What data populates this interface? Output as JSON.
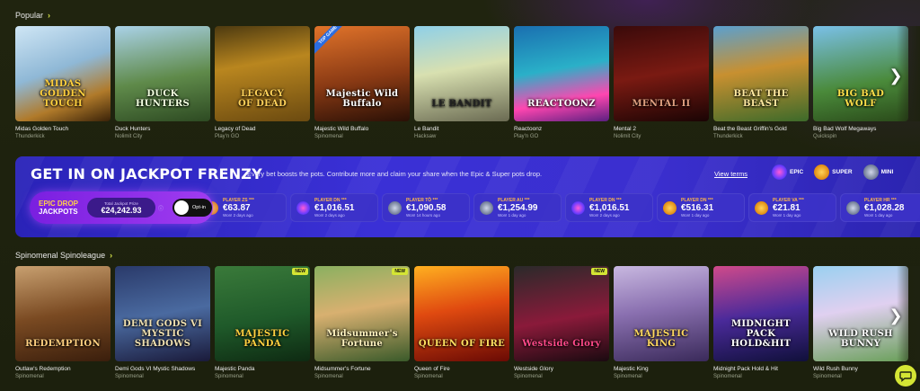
{
  "popular": {
    "title": "Popular",
    "games": [
      {
        "name": "Midas Golden Touch",
        "provider": "Thunderkick",
        "logo": "MIDAS\nGOLDEN TOUCH",
        "bg": "linear-gradient(160deg,#cfe6f5 0%,#8fb8d6 45%,#b07a2a 75%,#3a2208 100%)",
        "logo_color": "#ffcf3d"
      },
      {
        "name": "Duck Hunters",
        "provider": "Nolimit City",
        "logo": "DUCK HUNTERS",
        "bg": "linear-gradient(170deg,#aad2e8 0%,#5f8a4a 55%,#2d4a22 100%)",
        "logo_color": "#f2ffe0"
      },
      {
        "name": "Legacy of Dead",
        "provider": "Play'n GO",
        "logo": "LEGACY\nOF DEAD",
        "bg": "linear-gradient(170deg,#4d3a10 0%,#b9861f 40%,#6b4a10 100%)",
        "logo_color": "#ffd25a"
      },
      {
        "name": "Majestic Wild Buffalo",
        "provider": "Spinomenal",
        "logo": "Majestic Wild Buffalo",
        "bg": "linear-gradient(170deg,#e0732a 0%,#8a3a14 55%,#2a1006 100%)",
        "logo_color": "#ffffff",
        "badge": "TOP GAME"
      },
      {
        "name": "Le Bandit",
        "provider": "Hacksaw",
        "logo": "LE BANDIT",
        "bg": "linear-gradient(170deg,#8fd0e8 0%,#d8e0b0 45%,#6a6a52 100%)",
        "logo_color": "#222222"
      },
      {
        "name": "Reactoonz",
        "provider": "Play'n GO",
        "logo": "REACTOONZ",
        "bg": "linear-gradient(170deg,#1a6fb0 0%,#2ab0c8 45%,#ff46b0 75%,#5a1f80 100%)",
        "logo_color": "#ffffff"
      },
      {
        "name": "Mental 2",
        "provider": "Nolimit City",
        "logo": "MENTAL II",
        "bg": "linear-gradient(170deg,#3a0a0a 0%,#7a1a12 50%,#1a0404 100%)",
        "logo_color": "#e0a080"
      },
      {
        "name": "Beat the Beast Griffin's Gold",
        "provider": "Thunderkick",
        "logo": "BEAT THE BEAST",
        "bg": "linear-gradient(170deg,#5aa0d0 0%,#c89030 45%,#3c6a2a 100%)",
        "logo_color": "#ffe9a0"
      },
      {
        "name": "Big Bad Wolf Megaways",
        "provider": "Quickspin",
        "logo": "BIG BAD\nWOLF",
        "bg": "linear-gradient(170deg,#7ac0e8 0%,#4a8a3a 60%,#2a4a1a 100%)",
        "logo_color": "#ffe04a"
      }
    ]
  },
  "jackpot": {
    "title": "GET IN ON JACKPOT FRENZY",
    "subtitle": "Every bet boosts the pots. Contribute more and claim your share when the Epic & Super pots drop.",
    "view_terms": "View terms",
    "tiers": [
      {
        "label": "EPIC",
        "icon": "epic-gem"
      },
      {
        "label": "SUPER",
        "icon": "super-gem"
      },
      {
        "label": "MINI",
        "icon": "mini-gem"
      }
    ],
    "epic_drop_line1": "EPIC DROP",
    "epic_drop_line2": "JACKPOTS",
    "total_label": "Total Jackpot Prize",
    "total_value": "€24,242.93",
    "info_glyph": "ⓘ",
    "optin_label": "Opt-in",
    "winners": [
      {
        "player": "PLAYER ZS ***",
        "amount": "€63.87",
        "won": "Won! 2 days ago",
        "tier": "super"
      },
      {
        "player": "PLAYER DN ***",
        "amount": "€1,016.51",
        "won": "Won! 2 days ago",
        "tier": "epic"
      },
      {
        "player": "PLAYER TÖ ***",
        "amount": "€1,090.58",
        "won": "Won! 14 hours ago",
        "tier": "mini"
      },
      {
        "player": "PLAYER AU ***",
        "amount": "€1,254.99",
        "won": "Won! 1 day ago",
        "tier": "mini"
      },
      {
        "player": "PLAYER DN ***",
        "amount": "€1,016.51",
        "won": "Won! 2 days ago",
        "tier": "epic"
      },
      {
        "player": "PLAYER DN ***",
        "amount": "€516.31",
        "won": "Won! 1 day ago",
        "tier": "super"
      },
      {
        "player": "PLAYER VA ***",
        "amount": "€21.81",
        "won": "Won! 1 day ago",
        "tier": "super"
      },
      {
        "player": "PLAYER HR ***",
        "amount": "€1,028.28",
        "won": "Won! 1 day ago",
        "tier": "mini"
      }
    ]
  },
  "spinoleague": {
    "title": "Spinomenal Spinoleague",
    "games": [
      {
        "name": "Outlaw's Redemption",
        "provider": "Spinomenal",
        "logo": "REDEMPTION",
        "bg": "linear-gradient(170deg,#c8a070 0%,#7a4a22 50%,#3a1e0c 100%)",
        "logo_color": "#ffd080"
      },
      {
        "name": "Demi Gods VI Mystic Shadows",
        "provider": "Spinomenal",
        "logo": "DEMI GODS VI\nMYSTIC SHADOWS",
        "bg": "linear-gradient(170deg,#2a3a6a 0%,#4a6aa0 50%,#1a1a3a 100%)",
        "logo_color": "#f0e0b0"
      },
      {
        "name": "Majestic Panda",
        "provider": "Spinomenal",
        "logo": "MAJESTIC PANDA",
        "bg": "linear-gradient(170deg,#3a7a3a 0%,#1f5a2a 55%,#0e2a12 100%)",
        "logo_color": "#ffd040",
        "badge_new": "NEW"
      },
      {
        "name": "Midsummer's Fortune",
        "provider": "Spinomenal",
        "logo": "Midsummer's\nFortune",
        "bg": "linear-gradient(170deg,#8ab060 0%,#d8b070 45%,#3a5a2a 100%)",
        "logo_color": "#fff3c0",
        "badge_new": "NEW"
      },
      {
        "name": "Queen of Fire",
        "provider": "Spinomenal",
        "logo": "QUEEN OF FIRE",
        "bg": "linear-gradient(170deg,#ffb020 0%,#e04a10 45%,#6a0a04 100%)",
        "logo_color": "#ffe060"
      },
      {
        "name": "Westside Glory",
        "provider": "Spinomenal",
        "logo": "Westside Glory",
        "bg": "linear-gradient(170deg,#2a2a2a 0%,#8a1a3a 55%,#1a0a10 100%)",
        "logo_color": "#ff4a8a",
        "badge_new": "NEW"
      },
      {
        "name": "Majestic King",
        "provider": "Spinomenal",
        "logo": "MAJESTIC\nKING",
        "bg": "linear-gradient(170deg,#c8b8e0 0%,#8a70b0 45%,#3a2a5a 100%)",
        "logo_color": "#ffd860"
      },
      {
        "name": "Midnight Pack Hold & Hit",
        "provider": "Spinomenal",
        "logo": "MIDNIGHT PACK\nHOLD&HIT",
        "bg": "linear-gradient(170deg,#d04a8a 0%,#4a2a9a 50%,#10103a 100%)",
        "logo_color": "#ffffff"
      },
      {
        "name": "Wild Rush Bunny",
        "provider": "Spinomenal",
        "logo": "WILD RUSH BUNNY",
        "bg": "linear-gradient(170deg,#9ad0f0 0%,#e0d0f0 45%,#6aa05a 100%)",
        "logo_color": "#ffffff"
      }
    ]
  },
  "icons": {
    "chevron": "›",
    "next_arrow": "❯",
    "chat": "💬"
  }
}
